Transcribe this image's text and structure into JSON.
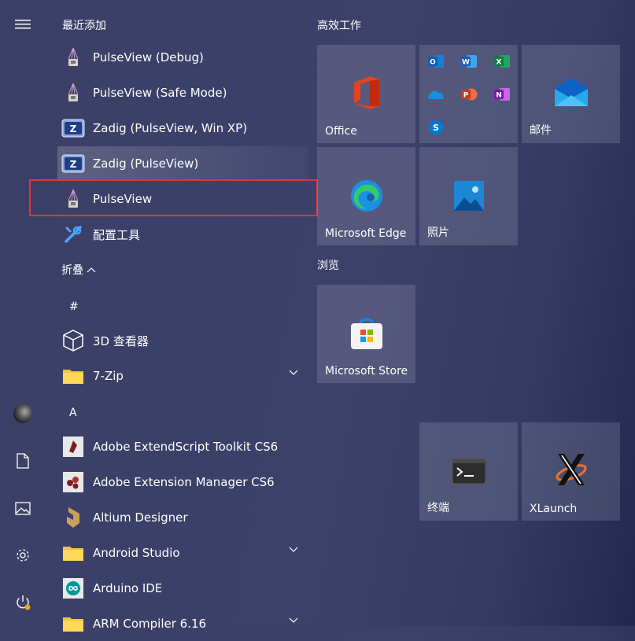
{
  "recent": {
    "header": "最近添加",
    "items": [
      {
        "label": "PulseView (Debug)"
      },
      {
        "label": "PulseView (Safe Mode)"
      },
      {
        "label": "Zadig (PulseView, Win XP)"
      },
      {
        "label": "Zadig (PulseView)"
      },
      {
        "label": "PulseView"
      },
      {
        "label": "配置工具"
      }
    ],
    "collapse": "折叠"
  },
  "alpha": {
    "hash": "#",
    "a": "A",
    "items": [
      {
        "label": "3D 查看器"
      },
      {
        "label": "7-Zip"
      },
      {
        "label": "Adobe ExtendScript Toolkit CS6"
      },
      {
        "label": "Adobe Extension Manager CS6"
      },
      {
        "label": "Altium Designer"
      },
      {
        "label": "Android Studio"
      },
      {
        "label": "Arduino IDE"
      },
      {
        "label": "ARM Compiler 6.16"
      }
    ]
  },
  "tiles": {
    "group1": "高效工作",
    "group2": "浏览",
    "office": "Office",
    "mail": "邮件",
    "edge": "Microsoft Edge",
    "photos": "照片",
    "store": "Microsoft Store",
    "terminal": "终端",
    "xlaunch": "XLaunch",
    "mini_letters": {
      "outlook": "O",
      "word": "W",
      "excel": "X",
      "ppt": "P",
      "onenote": "N",
      "skype": "S"
    }
  },
  "colors": {
    "highlight_border": "#e5333a",
    "accent": "#0078d4"
  }
}
